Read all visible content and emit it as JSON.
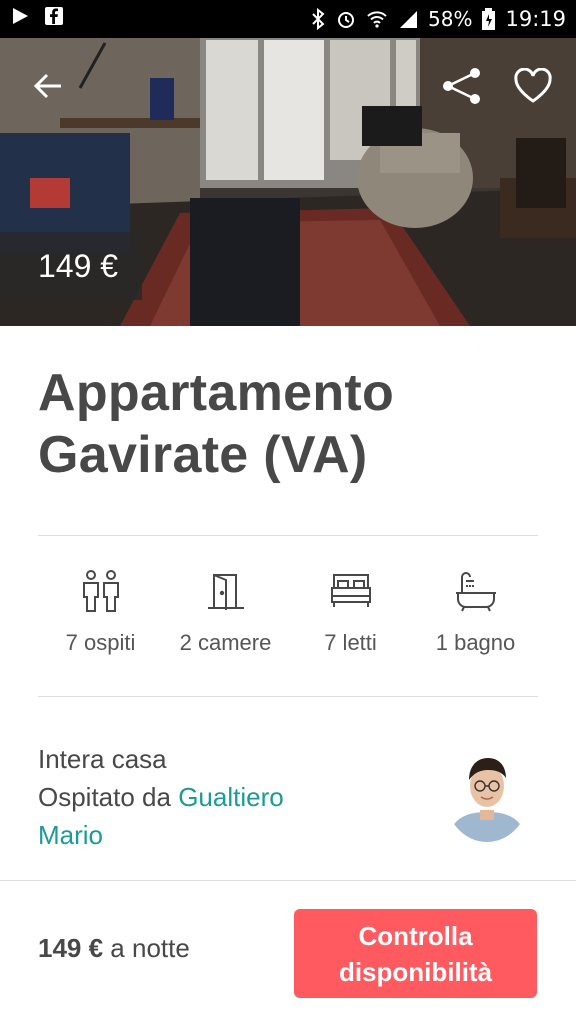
{
  "status_bar": {
    "battery": "58%",
    "time": "19:19"
  },
  "hero": {
    "price_badge": "149 €"
  },
  "listing": {
    "title_line1": "Appartamento",
    "title_line2": "Gavirate (VA)"
  },
  "amenities": [
    {
      "icon": "guests-icon",
      "label": "7 ospiti"
    },
    {
      "icon": "door-icon",
      "label": "2 camere"
    },
    {
      "icon": "bed-icon",
      "label": "7 letti"
    },
    {
      "icon": "bathtub-icon",
      "label": "1 bagno"
    }
  ],
  "host": {
    "room_type": "Intera casa",
    "hosted_by": "Ospitato da ",
    "host_first": "Gualtiero",
    "host_second": "Mario"
  },
  "booking": {
    "price": "149 €",
    "per": " a notte",
    "cta_line1": "Controlla",
    "cta_line2": "disponibilità"
  },
  "colors": {
    "accent": "#ff5a5f",
    "link": "#1a9a98",
    "text": "#484848"
  }
}
